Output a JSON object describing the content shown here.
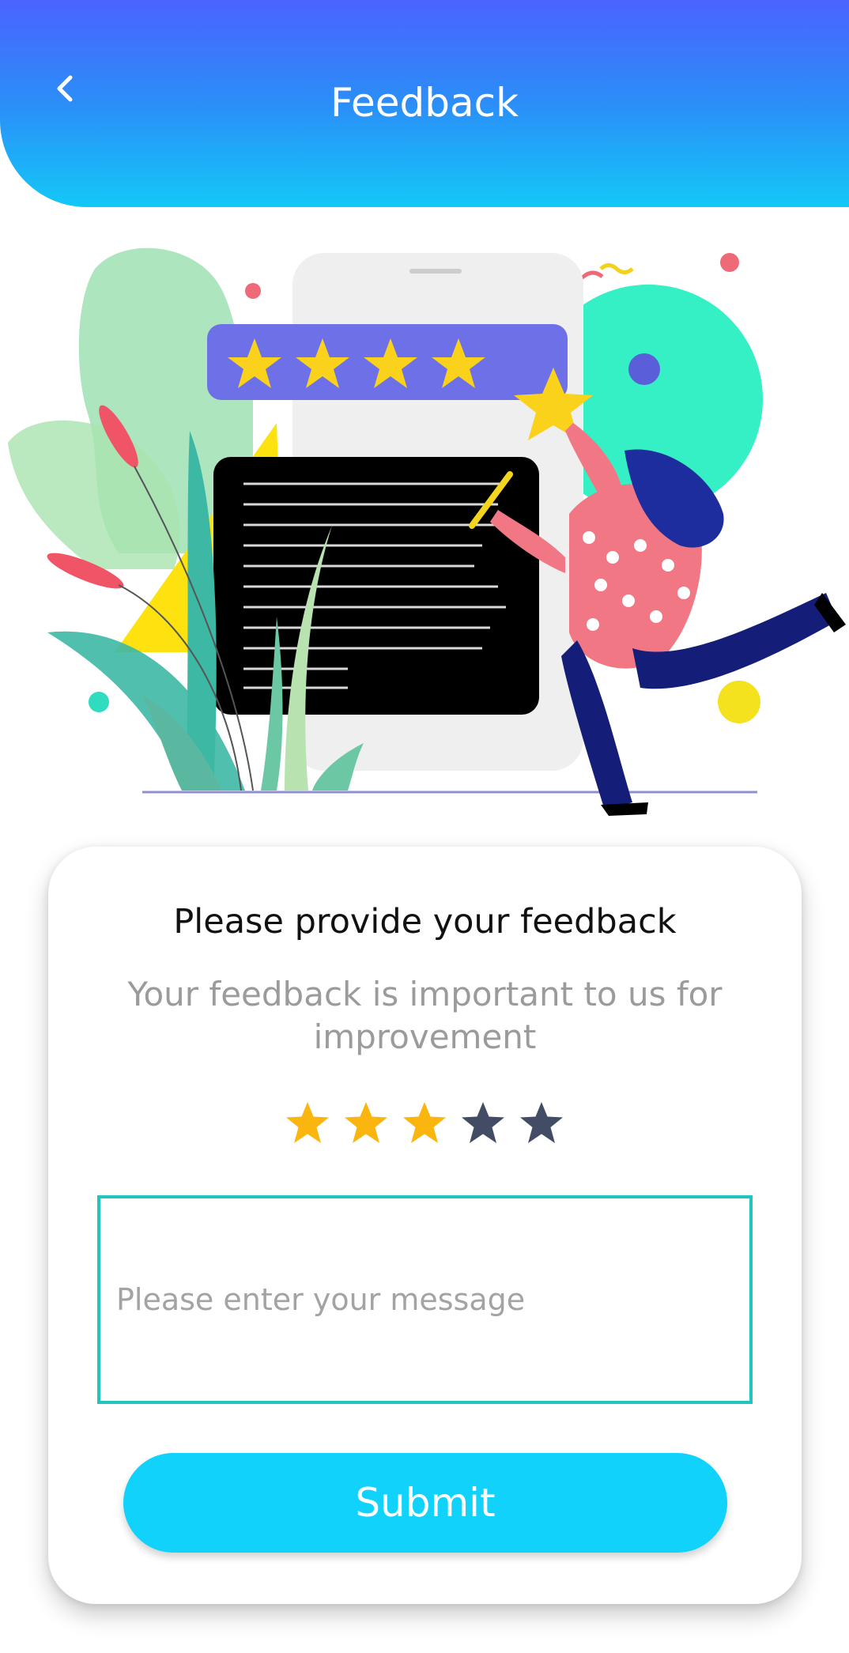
{
  "header": {
    "title": "Feedback",
    "back_icon": "chevron-left-icon"
  },
  "card": {
    "title": "Please provide your feedback",
    "subtitle": "Your feedback is important to us for improvement",
    "rating": {
      "value": 3,
      "max": 5
    },
    "message_placeholder": "Please enter your message",
    "message_value": "",
    "submit_label": "Submit"
  },
  "colors": {
    "header_top": "#4a63ff",
    "header_bottom": "#13c8f7",
    "star_filled": "#fbb50f",
    "star_empty": "#424c64",
    "input_border": "#20c6bd",
    "submit_bg": "#10d2fb"
  }
}
